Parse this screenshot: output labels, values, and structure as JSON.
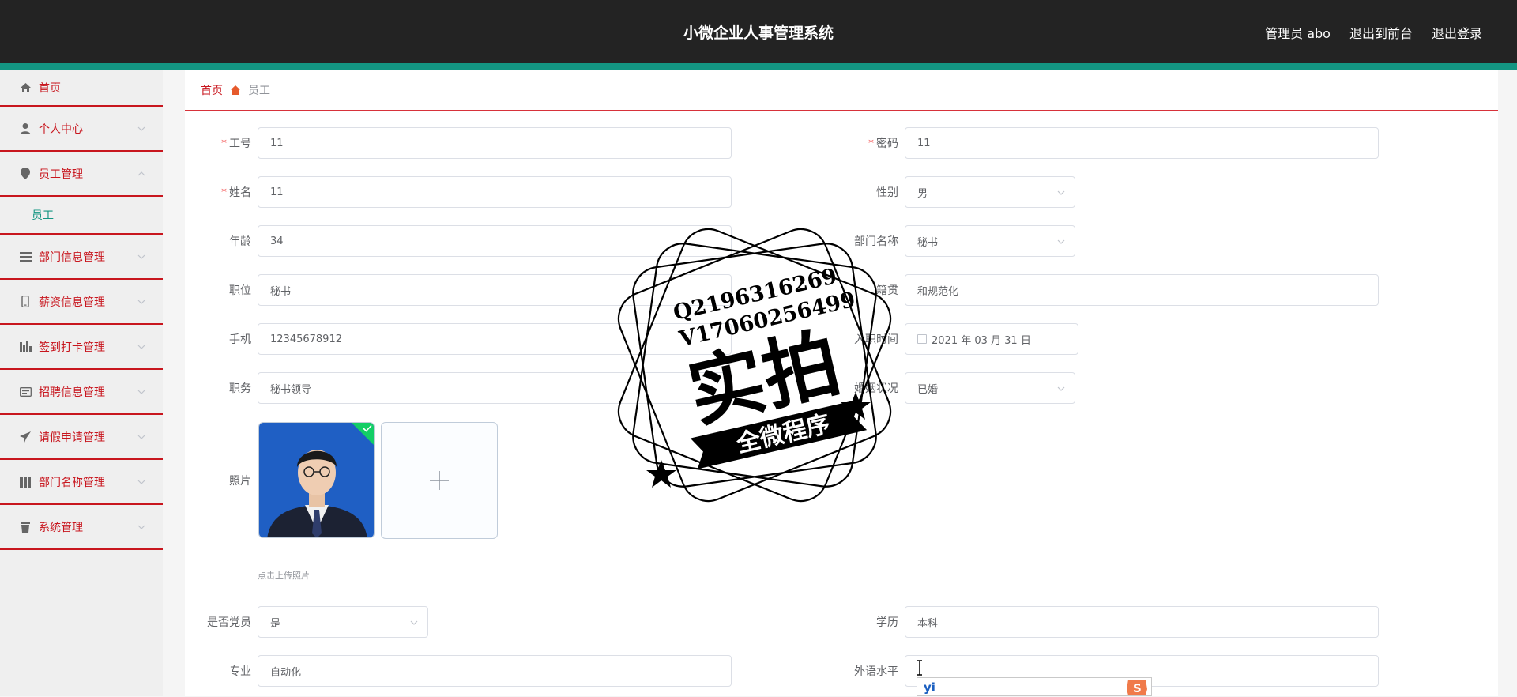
{
  "header": {
    "title": "小微企业人事管理系统",
    "user_label": "管理员 abo",
    "front_label": "退出到前台",
    "logout_label": "退出登录"
  },
  "sidebar": {
    "items": [
      {
        "label": "首页",
        "icon": "home-icon"
      },
      {
        "label": "个人中心",
        "icon": "user-icon"
      },
      {
        "label": "员工管理",
        "icon": "location-icon",
        "expanded": true
      },
      {
        "label": "部门信息管理",
        "icon": "menu-icon"
      },
      {
        "label": "薪资信息管理",
        "icon": "phone-icon"
      },
      {
        "label": "签到打卡管理",
        "icon": "chart-icon"
      },
      {
        "label": "招聘信息管理",
        "icon": "card-icon"
      },
      {
        "label": "请假申请管理",
        "icon": "send-icon"
      },
      {
        "label": "部门名称管理",
        "icon": "grid-icon"
      },
      {
        "label": "系统管理",
        "icon": "delete-icon"
      }
    ],
    "submenu_employee": "员工"
  },
  "breadcrumb": {
    "home": "首页",
    "current": "员工"
  },
  "form": {
    "gonghao": {
      "label": "工号",
      "value": "11"
    },
    "mima": {
      "label": "密码",
      "value": "11"
    },
    "xingming": {
      "label": "姓名",
      "value": "11"
    },
    "xingbie": {
      "label": "性别",
      "value": "男"
    },
    "nianling": {
      "label": "年龄",
      "value": "34"
    },
    "bumen": {
      "label": "部门名称",
      "value": "秘书"
    },
    "zhiwei": {
      "label": "职位",
      "value": "秘书"
    },
    "jiguan": {
      "label": "籍贯",
      "value": "和规范化"
    },
    "shouji": {
      "label": "手机",
      "value": "12345678912"
    },
    "ruzhi": {
      "label": "入职时间",
      "value": "2021 年 03 月 31 日"
    },
    "zhiwu": {
      "label": "职务",
      "value": "秘书领导"
    },
    "hunyin": {
      "label": "婚姻状况",
      "value": "已婚"
    },
    "zhaopian": {
      "label": "照片",
      "tip": "点击上传照片"
    },
    "dangyuan": {
      "label": "是否党员",
      "value": "是"
    },
    "xueli": {
      "label": "学历",
      "value": "本科"
    },
    "zhuanye": {
      "label": "专业",
      "value": "自动化"
    },
    "waiyu": {
      "label": "外语水平",
      "value": ""
    }
  },
  "watermark": {
    "line1": "Q2196316269",
    "line2": "V17060256499",
    "main": "实拍",
    "banner": "全微程序"
  },
  "ime": {
    "text": "yi"
  },
  "colors": {
    "header_bg": "#232323",
    "accent": "#139582",
    "menu_red": "#c8161e"
  }
}
